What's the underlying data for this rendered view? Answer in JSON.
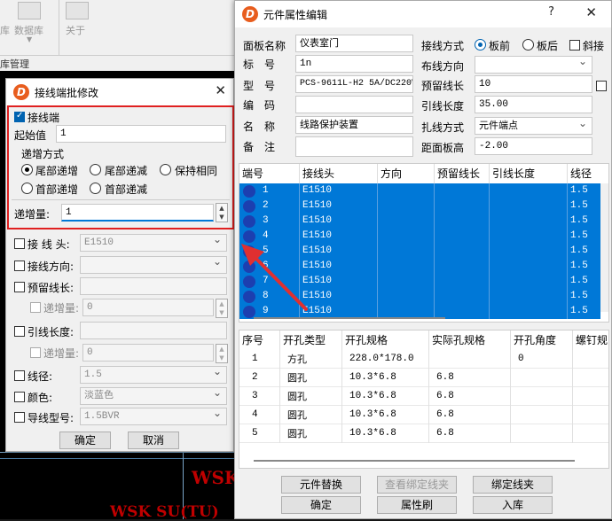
{
  "background": {
    "toolbar_item_database": "数据库",
    "toolbar_item_about": "关于",
    "toolbar_group": "库管理",
    "partial_label": "库",
    "canvas_text_1": "WSK",
    "canvas_text_2": "WSK SU(TU)"
  },
  "batch_dialog": {
    "title": "接线端批修改",
    "terminal_label": "接线端",
    "start_label": "起始值",
    "start_value": "1",
    "increment_mode_label": "递增方式",
    "modes": [
      "尾部递增",
      "尾部递减",
      "保持相同",
      "首部递增",
      "首部递减"
    ],
    "increment_label": "递增量:",
    "increment_value": "1",
    "head_label": "接 线 头:",
    "head_value": "E1510",
    "direction_label": "接线方向:",
    "reserve_label": "预留线长:",
    "reserve_step_label": "递增量:",
    "reserve_step_value": "0",
    "length_label": "引线长度:",
    "length_step_label": "递增量:",
    "length_step_value": "0",
    "diameter_label": "线径:",
    "diameter_value": "1.5",
    "color_label": "颜色:",
    "color_value": "淡蓝色",
    "wire_model_label": "导线型号:",
    "wire_model_value": "1.5BVR",
    "ok_label": "确定",
    "cancel_label": "取消"
  },
  "prop_dialog": {
    "title": "元件属性编辑",
    "help": "?",
    "close": "✕",
    "panel_name_label": "面板名称",
    "panel_name_value": "仪表室门",
    "tag_label": "标　号",
    "tag_value": "1n",
    "model_label": "型　号",
    "model_value": "PCS-9611L-H2 5A/DC220V",
    "code_label": "编　码",
    "code_value": "",
    "name_label": "名　称",
    "name_value": "线路保护装置",
    "note_label": "备　注",
    "note_value": "",
    "wiring_mode_label": "接线方式",
    "wiring_front": "板前",
    "wiring_back": "板后",
    "slant_label": "斜接",
    "route_dir_label": "布线方向",
    "route_dir_value": "",
    "reserve_label": "预留线长",
    "reserve_value": "10",
    "lead_len_label": "引线长度",
    "lead_len_value": "35.00",
    "tie_mode_label": "扎线方式",
    "tie_mode_value": "元件端点",
    "board_dist_label": "距面板高",
    "board_dist_value": "-2.00",
    "terminal_columns": [
      "端号",
      "接线头",
      "方向",
      "预留线长",
      "引线长度",
      "线径"
    ],
    "terminal_rows": [
      {
        "no": "1",
        "head": "E1510",
        "gauge": "1.5"
      },
      {
        "no": "2",
        "head": "E1510",
        "gauge": "1.5"
      },
      {
        "no": "3",
        "head": "E1510",
        "gauge": "1.5"
      },
      {
        "no": "4",
        "head": "E1510",
        "gauge": "1.5"
      },
      {
        "no": "5",
        "head": "E1510",
        "gauge": "1.5"
      },
      {
        "no": "6",
        "head": "E1510",
        "gauge": "1.5"
      },
      {
        "no": "7",
        "head": "E1510",
        "gauge": "1.5"
      },
      {
        "no": "8",
        "head": "E1510",
        "gauge": "1.5"
      },
      {
        "no": "9",
        "head": "E1510",
        "gauge": "1.5"
      }
    ],
    "hole_columns": [
      "序号",
      "开孔类型",
      "开孔规格",
      "实际孔规格",
      "开孔角度",
      "螺钉规"
    ],
    "hole_rows": [
      {
        "no": "1",
        "type": "方孔",
        "spec": "228.0*178.0",
        "actual": "",
        "angle": "0"
      },
      {
        "no": "2",
        "type": "圆孔",
        "spec": "10.3*6.8",
        "actual": "6.8",
        "angle": ""
      },
      {
        "no": "3",
        "type": "圆孔",
        "spec": "10.3*6.8",
        "actual": "6.8",
        "angle": ""
      },
      {
        "no": "4",
        "type": "圆孔",
        "spec": "10.3*6.8",
        "actual": "6.8",
        "angle": ""
      },
      {
        "no": "5",
        "type": "圆孔",
        "spec": "10.3*6.8",
        "actual": "6.8",
        "angle": ""
      }
    ],
    "replace_label": "元件替换",
    "view_bind_label": "查看绑定线夹",
    "bind_label": "绑定线夹",
    "ok_label": "确定",
    "brush_label": "属性刷",
    "store_label": "入库"
  },
  "colors": {
    "selection": "#0078d7",
    "highlight_box": "#e02020",
    "brand": "#e85d1e"
  }
}
